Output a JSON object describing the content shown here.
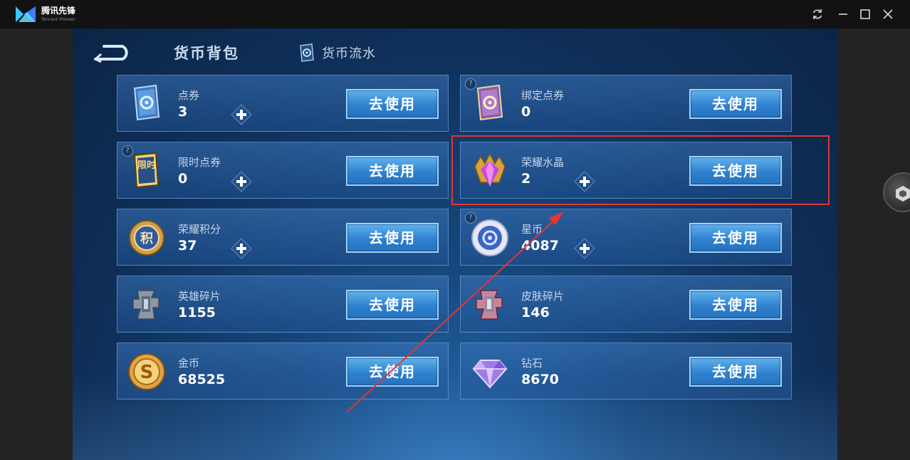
{
  "window": {
    "brand": "腾讯先锋",
    "brand_sub": "Tencent Pioneer",
    "controls": [
      "refresh-icon",
      "minimize-icon",
      "maximize-icon",
      "close-icon"
    ]
  },
  "header": {
    "active_tab": "货币背包",
    "flow_tab": "货币流水"
  },
  "button_label": "去使用",
  "currencies": [
    {
      "name": "点券",
      "value": "3",
      "icon": "coupon-icon",
      "has_plus": true,
      "has_help": false
    },
    {
      "name": "绑定点券",
      "value": "0",
      "icon": "bound-coupon-icon",
      "has_plus": false,
      "has_help": true
    },
    {
      "name": "限时点券",
      "value": "0",
      "icon": "limited-coupon-icon",
      "icon_text": "限时",
      "has_plus": true,
      "has_help": true
    },
    {
      "name": "荣耀水晶",
      "value": "2",
      "icon": "glory-crystal-icon",
      "has_plus": true,
      "has_help": false
    },
    {
      "name": "荣耀积分",
      "value": "37",
      "icon": "glory-points-icon",
      "icon_text": "积",
      "has_plus": true,
      "has_help": false
    },
    {
      "name": "星币",
      "value": "4087",
      "icon": "star-coin-icon",
      "has_plus": true,
      "has_help": true
    },
    {
      "name": "英雄碎片",
      "value": "1155",
      "icon": "hero-shard-icon",
      "has_plus": false,
      "has_help": false
    },
    {
      "name": "皮肤碎片",
      "value": "146",
      "icon": "skin-shard-icon",
      "has_plus": false,
      "has_help": false
    },
    {
      "name": "金币",
      "value": "68525",
      "icon": "gold-coin-icon",
      "icon_text": "S",
      "has_plus": false,
      "has_help": false
    },
    {
      "name": "钻石",
      "value": "8670",
      "icon": "diamond-icon",
      "has_plus": false,
      "has_help": false
    }
  ],
  "colors": {
    "annotation": "#e23535",
    "button": "#2f82cf",
    "background": "#0f2f58"
  }
}
